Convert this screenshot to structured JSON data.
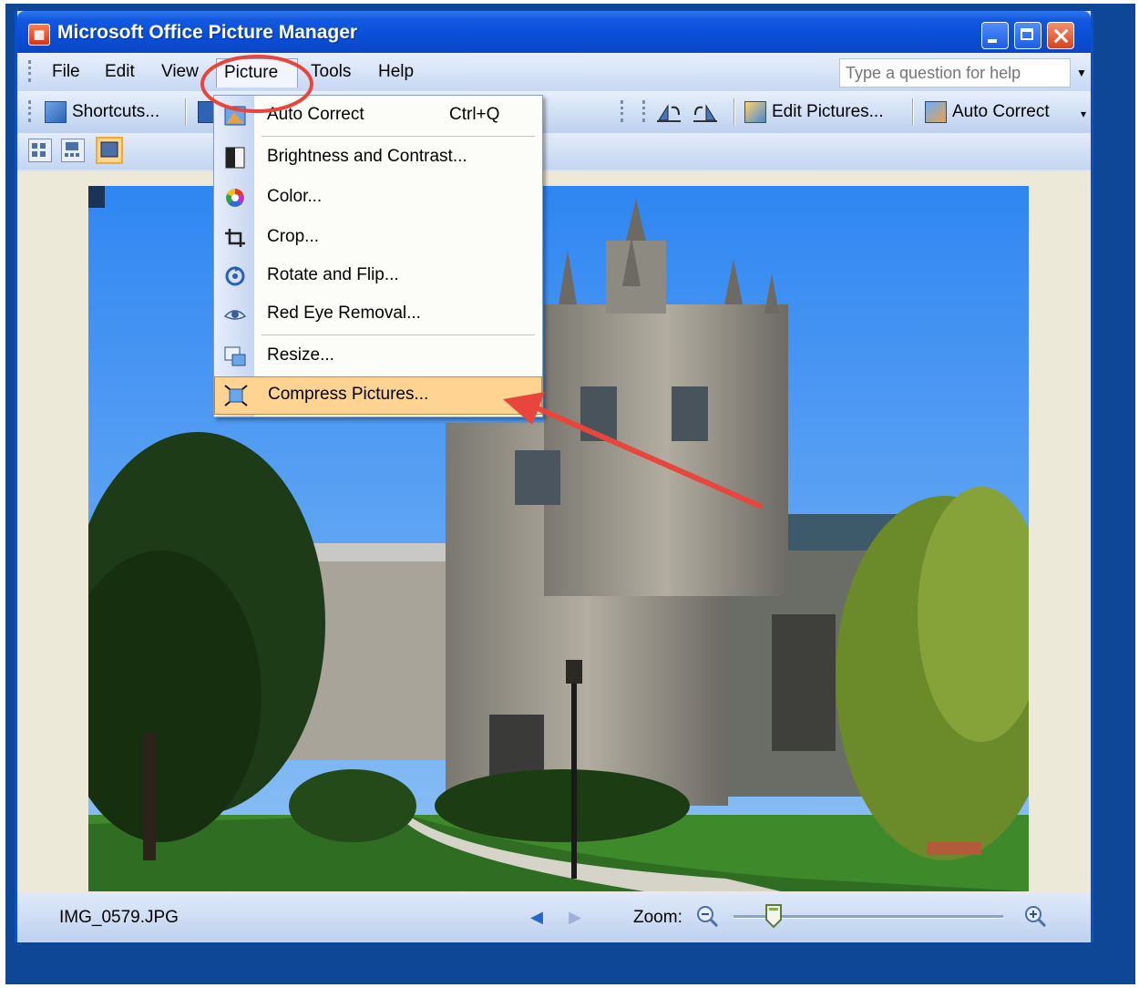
{
  "window": {
    "title": "Microsoft Office Picture Manager"
  },
  "menubar": {
    "items": [
      "File",
      "Edit",
      "View",
      "Picture",
      "Tools",
      "Help"
    ],
    "active": "Picture",
    "help_placeholder": "Type a question for help"
  },
  "toolbar": {
    "shortcuts": "Shortcuts...",
    "edit_pictures": "Edit Pictures...",
    "auto_correct": "Auto Correct"
  },
  "picture_menu": {
    "items": [
      {
        "label": "Auto Correct",
        "shortcut": "Ctrl+Q",
        "icon": "auto-correct-icon"
      },
      {
        "label": "Brightness and Contrast...",
        "shortcut": "",
        "icon": "brightness-icon"
      },
      {
        "label": "Color...",
        "shortcut": "",
        "icon": "color-wheel-icon"
      },
      {
        "label": "Crop...",
        "shortcut": "",
        "icon": "crop-icon"
      },
      {
        "label": "Rotate and Flip...",
        "shortcut": "",
        "icon": "rotate-icon"
      },
      {
        "label": "Red Eye Removal...",
        "shortcut": "",
        "icon": "eye-icon"
      },
      {
        "label": "Resize...",
        "shortcut": "",
        "icon": "resize-icon"
      },
      {
        "label": "Compress Pictures...",
        "shortcut": "",
        "icon": "compress-icon"
      }
    ],
    "highlighted": "Compress Pictures..."
  },
  "statusbar": {
    "filename": "IMG_0579.JPG",
    "zoom_label": "Zoom:"
  },
  "colors": {
    "titlebar": "#0a4ed8",
    "highlight": "#ffd391",
    "annotation": "#e8453c"
  }
}
